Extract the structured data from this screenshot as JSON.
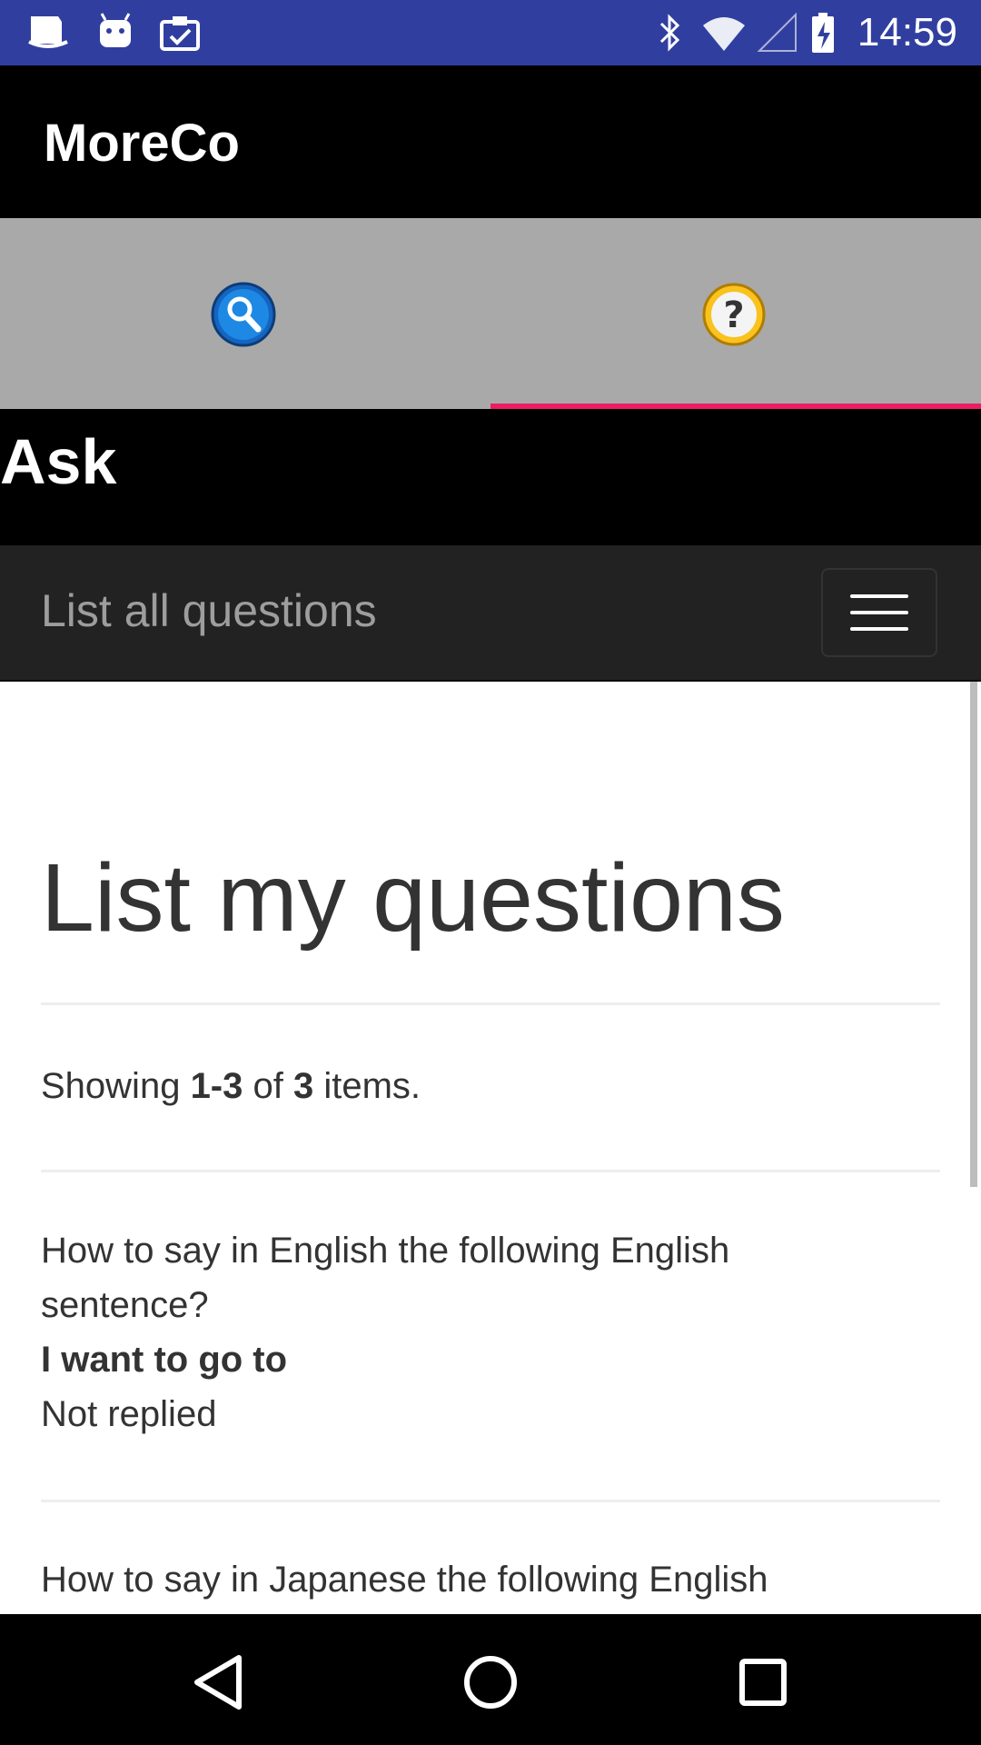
{
  "status_bar": {
    "time": "14:59",
    "left_icons": [
      "files-icon",
      "android-icon",
      "clipboard-check-icon"
    ],
    "right_icons": [
      "bluetooth-icon",
      "wifi-icon",
      "cell-signal-icon",
      "battery-charging-icon"
    ]
  },
  "app_bar": {
    "title": "MoreCo"
  },
  "tabs": [
    {
      "icon": "search-icon",
      "selected": false
    },
    {
      "icon": "question-icon",
      "selected": true
    }
  ],
  "page_header": {
    "title": "Ask"
  },
  "navbar": {
    "brand": "List all questions",
    "toggle_icon": "hamburger-menu-icon"
  },
  "content": {
    "title": "List my questions",
    "summary": {
      "prefix": "Showing ",
      "range": "1-3",
      "mid": " of ",
      "total": "3",
      "suffix": " items."
    },
    "questions": [
      {
        "text": "How to say in English the following English sentence?",
        "sentence": "I want to go to",
        "status": "Not replied"
      },
      {
        "text": "How to say in Japanese the following English"
      }
    ]
  },
  "colors": {
    "status_bar": "#303f9f",
    "tab_bg": "#a9a9a9",
    "tab_indicator": "#e91e63",
    "navbar_bg": "#222222",
    "text": "#333333"
  },
  "bottom_nav": {
    "icons": [
      "back-icon",
      "home-icon",
      "recents-icon"
    ]
  }
}
